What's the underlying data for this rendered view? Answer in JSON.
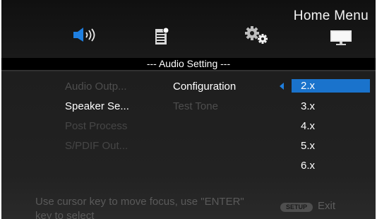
{
  "header": {
    "title": "Home Menu",
    "icons": [
      "audio-icon",
      "document-icon",
      "gear-icon",
      "monitor-icon"
    ],
    "active_icon": "audio-icon"
  },
  "section": {
    "title": "--- Audio Setting ---"
  },
  "menu": {
    "items": [
      {
        "label": "Audio Outp...",
        "state": "dim"
      },
      {
        "label": "Speaker Se...",
        "state": "active"
      },
      {
        "label": "Post Process",
        "state": "dim"
      },
      {
        "label": "S/PDIF Out...",
        "state": "dim"
      }
    ]
  },
  "submenu": {
    "items": [
      {
        "label": "Configuration",
        "state": "active"
      },
      {
        "label": "Test Tone",
        "state": "dim"
      }
    ]
  },
  "options": {
    "items": [
      "2.x",
      "3.x",
      "4.x",
      "5.x",
      "6.x"
    ],
    "selected": "2.x"
  },
  "footer": {
    "help_text": "Use cursor key to move focus, use \"ENTER\" key to select",
    "setup_label": "SETUP",
    "exit_label": "Exit"
  },
  "colors": {
    "accent": "#1a73cc",
    "active_icon": "#1f7fe0",
    "text": "#ffffff",
    "dim_text": "#4e4e4e"
  }
}
